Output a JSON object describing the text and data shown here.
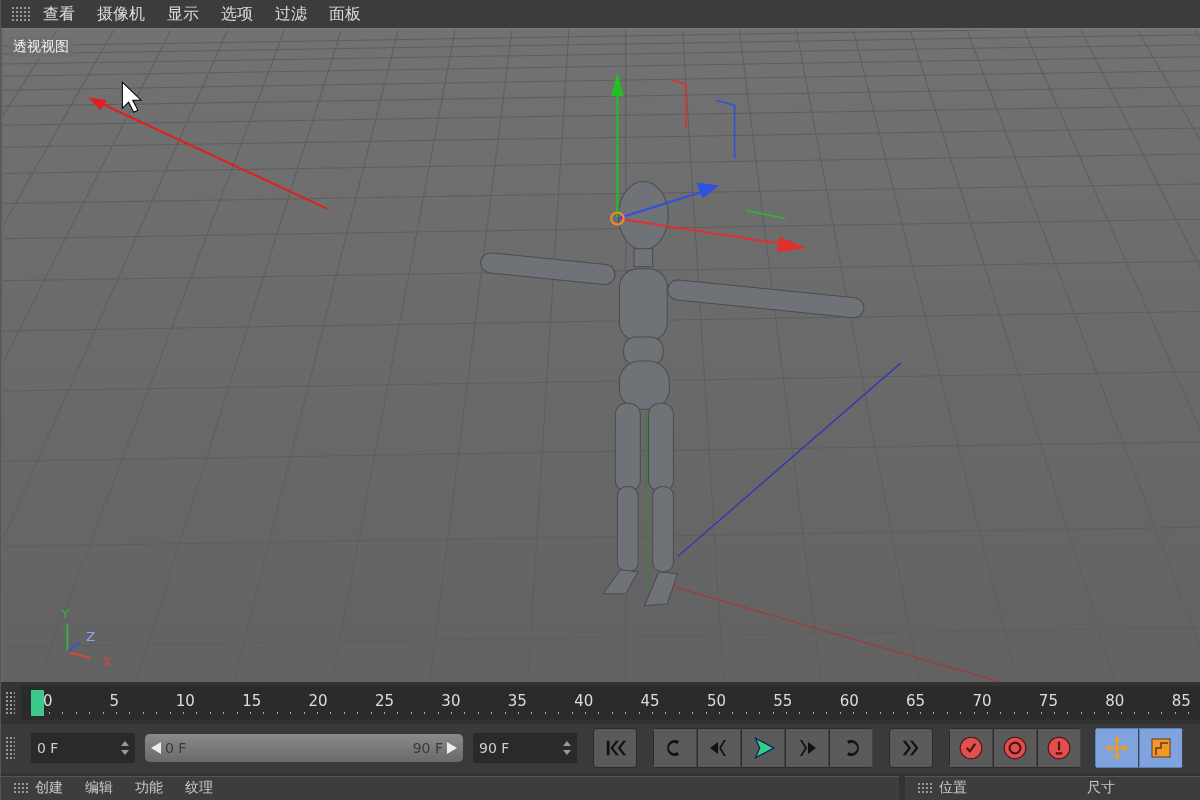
{
  "menu_items": [
    "查看",
    "摄像机",
    "显示",
    "选项",
    "过滤",
    "面板"
  ],
  "viewport": {
    "label": "透视视图",
    "axes": {
      "x": "X",
      "y": "Y",
      "z": "Z"
    }
  },
  "timeline": {
    "labels": [
      "0",
      "5",
      "10",
      "15",
      "20",
      "25",
      "30",
      "35",
      "40",
      "45",
      "50",
      "55",
      "60",
      "65",
      "70",
      "75",
      "80",
      "85"
    ]
  },
  "controls": {
    "start_field": "0 F",
    "range": {
      "start": "0 F",
      "end": "90 F",
      "level": 1
    },
    "end_field": "90 F"
  },
  "bottom": {
    "left_tabs": [
      "创建",
      "编辑",
      "功能",
      "纹理"
    ],
    "right_headings": [
      "位置",
      "尺寸"
    ]
  }
}
